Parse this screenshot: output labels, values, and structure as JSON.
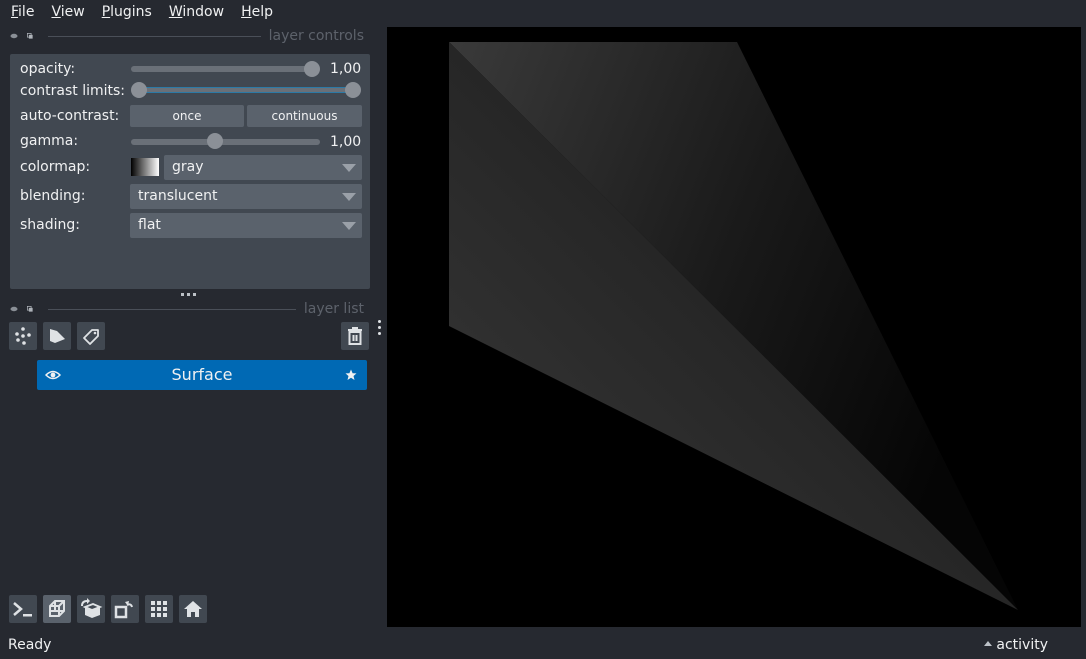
{
  "menu": [
    {
      "label": "File",
      "mnemonic": "F",
      "rest": "ile"
    },
    {
      "label": "View",
      "mnemonic": "V",
      "rest": "iew"
    },
    {
      "label": "Plugins",
      "mnemonic": "P",
      "rest": "lugins"
    },
    {
      "label": "Window",
      "mnemonic": "W",
      "rest": "indow"
    },
    {
      "label": "Help",
      "mnemonic": "H",
      "rest": "elp"
    }
  ],
  "layer_controls": {
    "title": "layer controls",
    "opacity": {
      "label": "opacity:",
      "value": 1.0,
      "display": "1,00"
    },
    "contrast_limits": {
      "label": "contrast limits:",
      "low": 0.0,
      "high": 1.0
    },
    "auto_contrast": {
      "label": "auto-contrast:",
      "once": "once",
      "continuous": "continuous"
    },
    "gamma": {
      "label": "gamma:",
      "value": 1.0,
      "display": "1,00",
      "fraction": 0.44
    },
    "colormap": {
      "label": "colormap:",
      "value": "gray"
    },
    "blending": {
      "label": "blending:",
      "value": "translucent"
    },
    "shading": {
      "label": "shading:",
      "value": "flat"
    }
  },
  "layer_list": {
    "title": "layer list",
    "tools": [
      "new-points-layer",
      "new-shapes-layer",
      "new-labels-layer"
    ],
    "delete": "delete-layer",
    "layers": [
      {
        "name": "Surface",
        "visible": true,
        "selected": true
      }
    ]
  },
  "bottom_buttons": [
    "console",
    "ndisplay-3d",
    "roll-dims",
    "transpose-dims",
    "grid-view",
    "home"
  ],
  "status": {
    "text": "Ready",
    "activity": "activity"
  },
  "canvas": {
    "background": "#000000",
    "layer_color": "#ffffff"
  }
}
